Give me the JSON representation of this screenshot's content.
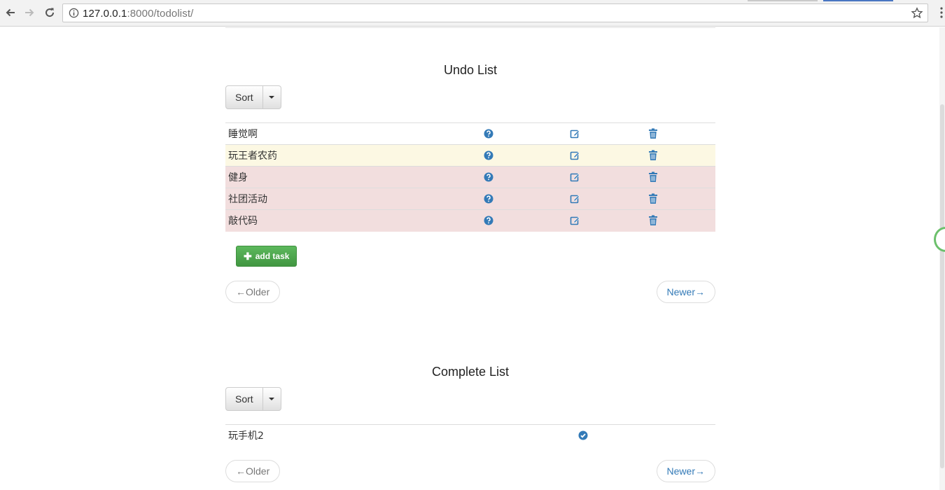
{
  "browser": {
    "url_host": "127.0.0.1",
    "url_rest": ":8000/todolist/"
  },
  "undo": {
    "title": "Undo List",
    "sort_label": "Sort",
    "rows": [
      {
        "label": "睡觉啊",
        "state": "default"
      },
      {
        "label": "玩王者农药",
        "state": "warning"
      },
      {
        "label": "健身",
        "state": "danger"
      },
      {
        "label": "社团活动",
        "state": "danger"
      },
      {
        "label": "敲代码",
        "state": "danger"
      }
    ],
    "add_label": "add task",
    "older_label": "←Older",
    "newer_label": "Newer→"
  },
  "complete": {
    "title": "Complete List",
    "sort_label": "Sort",
    "rows": [
      {
        "label": "玩手机2"
      }
    ],
    "older_label": "←Older",
    "newer_label": "Newer→"
  },
  "colors": {
    "primary": "#337ab7",
    "success": "#5cb85c",
    "warning_row": "#fcf8e3",
    "danger_row": "#f2dede"
  }
}
